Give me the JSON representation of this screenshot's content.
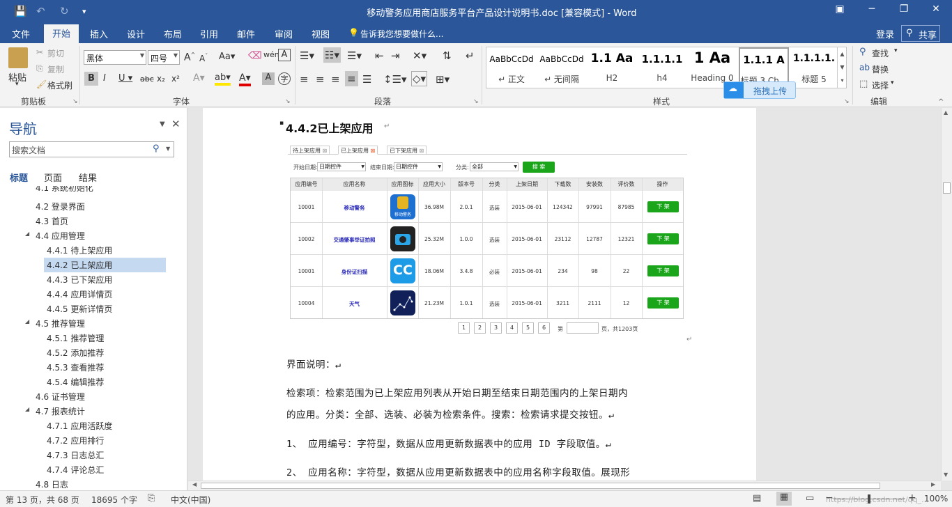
{
  "titlebar": {
    "title": "移动警务应用商店服务平台产品设计说明书.doc [兼容模式] - Word",
    "save_glyph": "💾",
    "undo_glyph": "↶",
    "redo_glyph": "↻",
    "customize_glyph": "▾"
  },
  "tabs": [
    "文件",
    "开始",
    "插入",
    "设计",
    "布局",
    "引用",
    "邮件",
    "审阅",
    "视图"
  ],
  "tell_me": "告诉我您想要做什么...",
  "login": "登录",
  "share": "共享",
  "ribbon": {
    "clipboard": {
      "paste": "粘贴",
      "cut": "剪切",
      "copy": "复制",
      "format_painter": "格式刷",
      "label": "剪贴板"
    },
    "font": {
      "name": "黑体",
      "size": "四号",
      "label": "字体"
    },
    "paragraph": {
      "label": "段落"
    },
    "styles": {
      "label": "样式",
      "items": [
        {
          "preview": "AaBbCcDd",
          "name": "↵ 正文"
        },
        {
          "preview": "AaBbCcDd",
          "name": "↵ 无间隔"
        },
        {
          "preview": "1.1 Aa",
          "name": "H2"
        },
        {
          "preview": "1.1.1.1",
          "name": "h4"
        },
        {
          "preview": "1 Aa",
          "name": "Heading 0"
        },
        {
          "preview": "1.1.1 A",
          "name": "标题 3 Ch..."
        },
        {
          "preview": "1.1.1.1.",
          "name": "标题 5"
        }
      ]
    },
    "editing": {
      "find": "查找",
      "replace": "替换",
      "select": "选择",
      "label": "编辑"
    },
    "upload_badge": "拖拽上传"
  },
  "nav": {
    "title": "导航",
    "search_placeholder": "搜索文档",
    "tabs": [
      "标题",
      "页面",
      "结果"
    ],
    "items": [
      {
        "label": "4.1 系统初始化",
        "level": 1
      },
      {
        "label": "4.2 登录界面",
        "level": 1
      },
      {
        "label": "4.3 首页",
        "level": 1
      },
      {
        "label": "4.4 应用管理",
        "level": 1,
        "expanded": true
      },
      {
        "label": "4.4.1 待上架应用",
        "level": 2
      },
      {
        "label": "4.4.2 已上架应用",
        "level": 2,
        "selected": true
      },
      {
        "label": "4.4.3 已下架应用",
        "level": 2
      },
      {
        "label": "4.4.4 应用详情页",
        "level": 2
      },
      {
        "label": "4.4.5 更新详情页",
        "level": 2
      },
      {
        "label": "4.5 推荐管理",
        "level": 1,
        "expanded": true
      },
      {
        "label": "4.5.1 推荐管理",
        "level": 2
      },
      {
        "label": "4.5.2 添加推荐",
        "level": 2
      },
      {
        "label": "4.5.3 查看推荐",
        "level": 2
      },
      {
        "label": "4.5.4 编辑推荐",
        "level": 2
      },
      {
        "label": "4.6 证书管理",
        "level": 1
      },
      {
        "label": "4.7 报表统计",
        "level": 1,
        "expanded": true
      },
      {
        "label": "4.7.1 应用活跃度",
        "level": 2
      },
      {
        "label": "4.7.2 应用排行",
        "level": 2
      },
      {
        "label": "4.7.3 日志总汇",
        "level": 2
      },
      {
        "label": "4.7.4 评论总汇",
        "level": 2
      },
      {
        "label": "4.8 日志",
        "level": 1
      }
    ]
  },
  "document": {
    "heading": "4.4.2已上架应用",
    "embedded": {
      "tabs": [
        "待上架应用",
        "已上架应用",
        "已下架应用"
      ],
      "filter": {
        "start_label": "开始日期:",
        "start_value": "日期控件",
        "end_label": "结束日期:",
        "end_value": "日期控件",
        "category_label": "分类:",
        "category_value": "全部",
        "search_button": "搜 索"
      },
      "columns": [
        "应用编号",
        "应用名称",
        "应用图标",
        "应用大小",
        "版本号",
        "分类",
        "上架日期",
        "下载数",
        "安装数",
        "评价数",
        "操作"
      ],
      "rows": [
        {
          "id": "10001",
          "name": "移动警务",
          "size": "36.98M",
          "version": "2.0.1",
          "category": "选装",
          "date": "2015-06-01",
          "downloads": "124342",
          "installs": "97991",
          "reviews": "87985",
          "action": "下 架"
        },
        {
          "id": "10002",
          "name": "交通肇事举证拍照",
          "size": "25.32M",
          "version": "1.0.0",
          "category": "选装",
          "date": "2015-06-01",
          "downloads": "23112",
          "installs": "12787",
          "reviews": "12321",
          "action": "下 架"
        },
        {
          "id": "10001",
          "name": "身份证扫描",
          "size": "18.06M",
          "version": "3.4.8",
          "category": "必装",
          "date": "2015-06-01",
          "downloads": "234",
          "installs": "98",
          "reviews": "22",
          "action": "下 架"
        },
        {
          "id": "10004",
          "name": "天气",
          "size": "21.23M",
          "version": "1.0.1",
          "category": "选装",
          "date": "2015-06-01",
          "downloads": "3211",
          "installs": "2111",
          "reviews": "12",
          "action": "下 架"
        }
      ],
      "icon_text": {
        "police": "移动警务",
        "cc": "CC"
      },
      "pager": {
        "pages": [
          "1",
          "2",
          "3",
          "4",
          "5",
          "6"
        ],
        "prefix": "第",
        "suffix": "页，共1203页"
      }
    },
    "paragraphs": [
      "界面说明：↵",
      "检索项：检索范围为已上架应用列表从开始日期至结束日期范围内的上架日期内",
      "的应用。分类：全部、选装、必装为检索条件。搜索：检索请求提交按钮。↵",
      "1、 应用编号：字符型，数据从应用更新数据表中的应用 ID 字段取值。↵",
      "2、 应用名称：字符型，数据从应用更新数据表中的应用名称字段取值。展现形"
    ]
  },
  "status": {
    "page": "第 13 页，共 68 页",
    "words": "18695 个字",
    "language": "中文(中国)",
    "zoom": "100%",
    "zoom_minus": "−",
    "zoom_plus": "+",
    "watermark": "https://blog.csdn.net/qq_..."
  },
  "colors": {
    "accent": "#2b579a",
    "nav_selected": "#c5d9f1",
    "green_button": "#1aa51a"
  }
}
